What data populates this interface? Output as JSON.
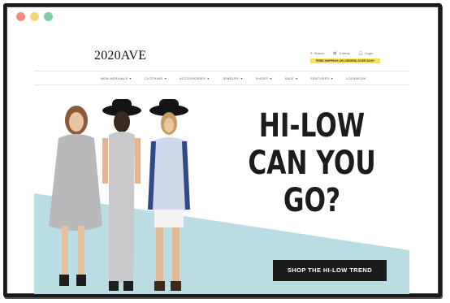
{
  "window": {
    "dots": [
      {
        "name": "close",
        "color": "#f28b82"
      },
      {
        "name": "minimize",
        "color": "#f7d774"
      },
      {
        "name": "maximize",
        "color": "#7fd1a4"
      }
    ]
  },
  "header": {
    "logo": "2020AVE",
    "search_label": "Search",
    "cart_label": "0 items",
    "login_label": "Login",
    "promo": "FREE SHIPPING ON ORDERS OVER $100*"
  },
  "nav": {
    "items": [
      {
        "label": "NEW ARRIVALS",
        "has_menu": true
      },
      {
        "label": "CLOTHING",
        "has_menu": true
      },
      {
        "label": "ACCESSORIES",
        "has_menu": true
      },
      {
        "label": "JEWELRY",
        "has_menu": true
      },
      {
        "label": "SHOES",
        "has_menu": true
      },
      {
        "label": "SALE",
        "has_menu": true
      },
      {
        "label": "FEATURES",
        "has_menu": true
      },
      {
        "label": "LOOKBOOK",
        "has_menu": false
      }
    ]
  },
  "hero": {
    "headline_line1": "HI-LOW",
    "headline_line2": "CAN YOU GO?",
    "cta_label": "SHOP THE HI-LOW TREND",
    "accent_color": "#b9dde3"
  }
}
